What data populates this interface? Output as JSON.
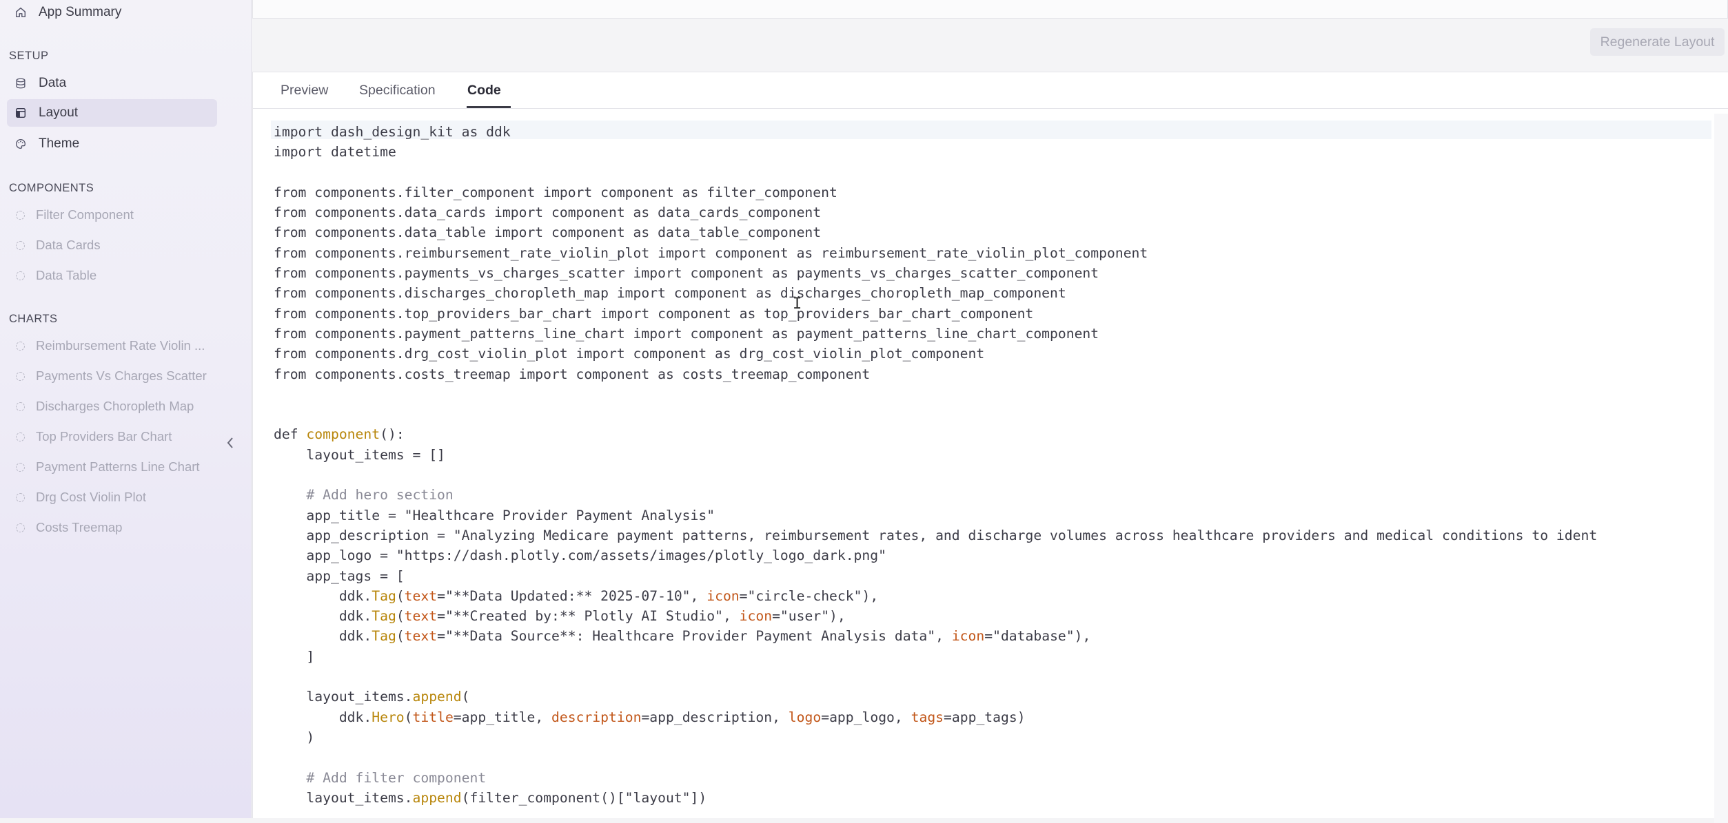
{
  "sidebar": {
    "top_item": {
      "label": "App Summary",
      "icon": "home-icon"
    },
    "setup_title": "SETUP",
    "setup_items": [
      {
        "label": "Data",
        "icon": "database-icon"
      },
      {
        "label": "Layout",
        "icon": "layout-icon",
        "active": true
      },
      {
        "label": "Theme",
        "icon": "palette-icon"
      }
    ],
    "components_title": "COMPONENTS",
    "components_items": [
      {
        "label": "Filter Component"
      },
      {
        "label": "Data Cards"
      },
      {
        "label": "Data Table"
      }
    ],
    "charts_title": "CHARTS",
    "charts_items": [
      {
        "label": "Reimbursement Rate Violin ..."
      },
      {
        "label": "Payments Vs Charges Scatter"
      },
      {
        "label": "Discharges Choropleth Map"
      },
      {
        "label": "Top Providers Bar Chart"
      },
      {
        "label": "Payment Patterns Line Chart"
      },
      {
        "label": "Drg Cost Violin Plot"
      },
      {
        "label": "Costs Treemap"
      }
    ],
    "collapse_icon": "chevron-left-icon"
  },
  "toolbar": {
    "regenerate_label": "Regenerate Layout"
  },
  "tabs": [
    {
      "label": "Preview"
    },
    {
      "label": "Specification"
    },
    {
      "label": "Code",
      "active": true
    }
  ],
  "code": {
    "lines": [
      "import dash_design_kit as ddk",
      "import datetime",
      "",
      "from components.filter_component import component as filter_component",
      "from components.data_cards import component as data_cards_component",
      "from components.data_table import component as data_table_component",
      "from components.reimbursement_rate_violin_plot import component as reimbursement_rate_violin_plot_component",
      "from components.payments_vs_charges_scatter import component as payments_vs_charges_scatter_component",
      "from components.discharges_choropleth_map import component as discharges_choropleth_map_component",
      "from components.top_providers_bar_chart import component as top_providers_bar_chart_component",
      "from components.payment_patterns_line_chart import component as payment_patterns_line_chart_component",
      "from components.drg_cost_violin_plot import component as drg_cost_violin_plot_component",
      "from components.costs_treemap import component as costs_treemap_component",
      "",
      "",
      "def component():",
      "    layout_items = []",
      "",
      "    # Add hero section",
      "    app_title = \"Healthcare Provider Payment Analysis\"",
      "    app_description = \"Analyzing Medicare payment patterns, reimbursement rates, and discharge volumes across healthcare providers and medical conditions to ident",
      "    app_logo = \"https://dash.plotly.com/assets/images/plotly_logo_dark.png\"",
      "    app_tags = [",
      "        ddk.Tag(text=\"**Data Updated:** 2025-07-10\", icon=\"circle-check\"),",
      "        ddk.Tag(text=\"**Created by:** Plotly AI Studio\", icon=\"user\"),",
      "        ddk.Tag(text=\"**Data Source**: Healthcare Provider Payment Analysis data\", icon=\"database\"),",
      "    ]",
      "",
      "    layout_items.append(",
      "        ddk.Hero(title=app_title, description=app_description, logo=app_logo, tags=app_tags)",
      "    )",
      "",
      "    # Add filter component",
      "    layout_items.append(filter_component()[\"layout\"])"
    ]
  }
}
